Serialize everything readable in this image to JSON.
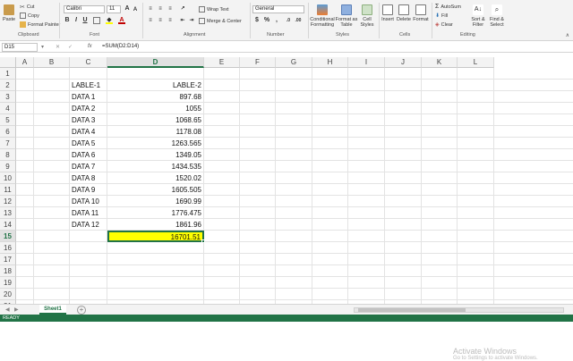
{
  "ribbon": {
    "clipboard": {
      "paste": "Paste",
      "cut": "Cut",
      "copy": "Copy",
      "format_painter": "Format Painter",
      "group": "Clipboard"
    },
    "font": {
      "name": "Calibri",
      "size": "11",
      "bold": "B",
      "italic": "I",
      "underline": "U",
      "group": "Font"
    },
    "alignment": {
      "wrap_text": "Wrap Text",
      "merge_center": "Merge & Center",
      "group": "Alignment"
    },
    "number": {
      "format": "General",
      "currency": "$",
      "percent": "%",
      "comma": ",",
      "group": "Number"
    },
    "styles": {
      "conditional": "Conditional Formatting",
      "format_as_table": "Format as Table",
      "cell_styles": "Cell Styles",
      "group": "Styles"
    },
    "cells": {
      "insert": "Insert",
      "delete": "Delete",
      "format": "Format",
      "group": "Cells"
    },
    "editing": {
      "autosum": "AutoSum",
      "fill": "Fill",
      "clear": "Clear",
      "sort_filter": "Sort & Filter",
      "find_select": "Find & Select",
      "group": "Editing"
    }
  },
  "formula_bar": {
    "name_box": "D15",
    "fx": "fx",
    "formula": "=SUM(D2:D14)"
  },
  "grid": {
    "columns": [
      "A",
      "B",
      "C",
      "D",
      "E",
      "F",
      "G",
      "H",
      "I",
      "J",
      "K",
      "L"
    ],
    "selected_column": "D",
    "rows": [
      "1",
      "2",
      "3",
      "4",
      "5",
      "6",
      "7",
      "8",
      "9",
      "10",
      "11",
      "12",
      "13",
      "14",
      "15",
      "16",
      "17",
      "18",
      "19",
      "20",
      "21"
    ],
    "selected_row": "15",
    "labels": [
      "LABLE-1",
      "DATA 1",
      "DATA 2",
      "DATA 3",
      "DATA 4",
      "DATA 5",
      "DATA 6",
      "DATA 7",
      "DATA 8",
      "DATA 9",
      "DATA 10",
      "DATA 11",
      "DATA 12"
    ],
    "values": [
      "LABLE-2",
      "897.68",
      "1055",
      "1068.65",
      "1178.08",
      "1263.565",
      "1349.05",
      "1434.535",
      "1520.02",
      "1605.505",
      "1690.99",
      "1776.475",
      "1861.96"
    ],
    "total": "16701.51",
    "highlight_color": "#ffff00"
  },
  "sheet_tabs": {
    "active": "Sheet1",
    "add": "+"
  },
  "status_bar": {
    "text": "READY"
  },
  "watermark": {
    "line1": "Activate Windows",
    "line2": "Go to Settings to activate Windows."
  },
  "colors": {
    "accent": "#217346",
    "header_bg": "#f3f3f3"
  }
}
